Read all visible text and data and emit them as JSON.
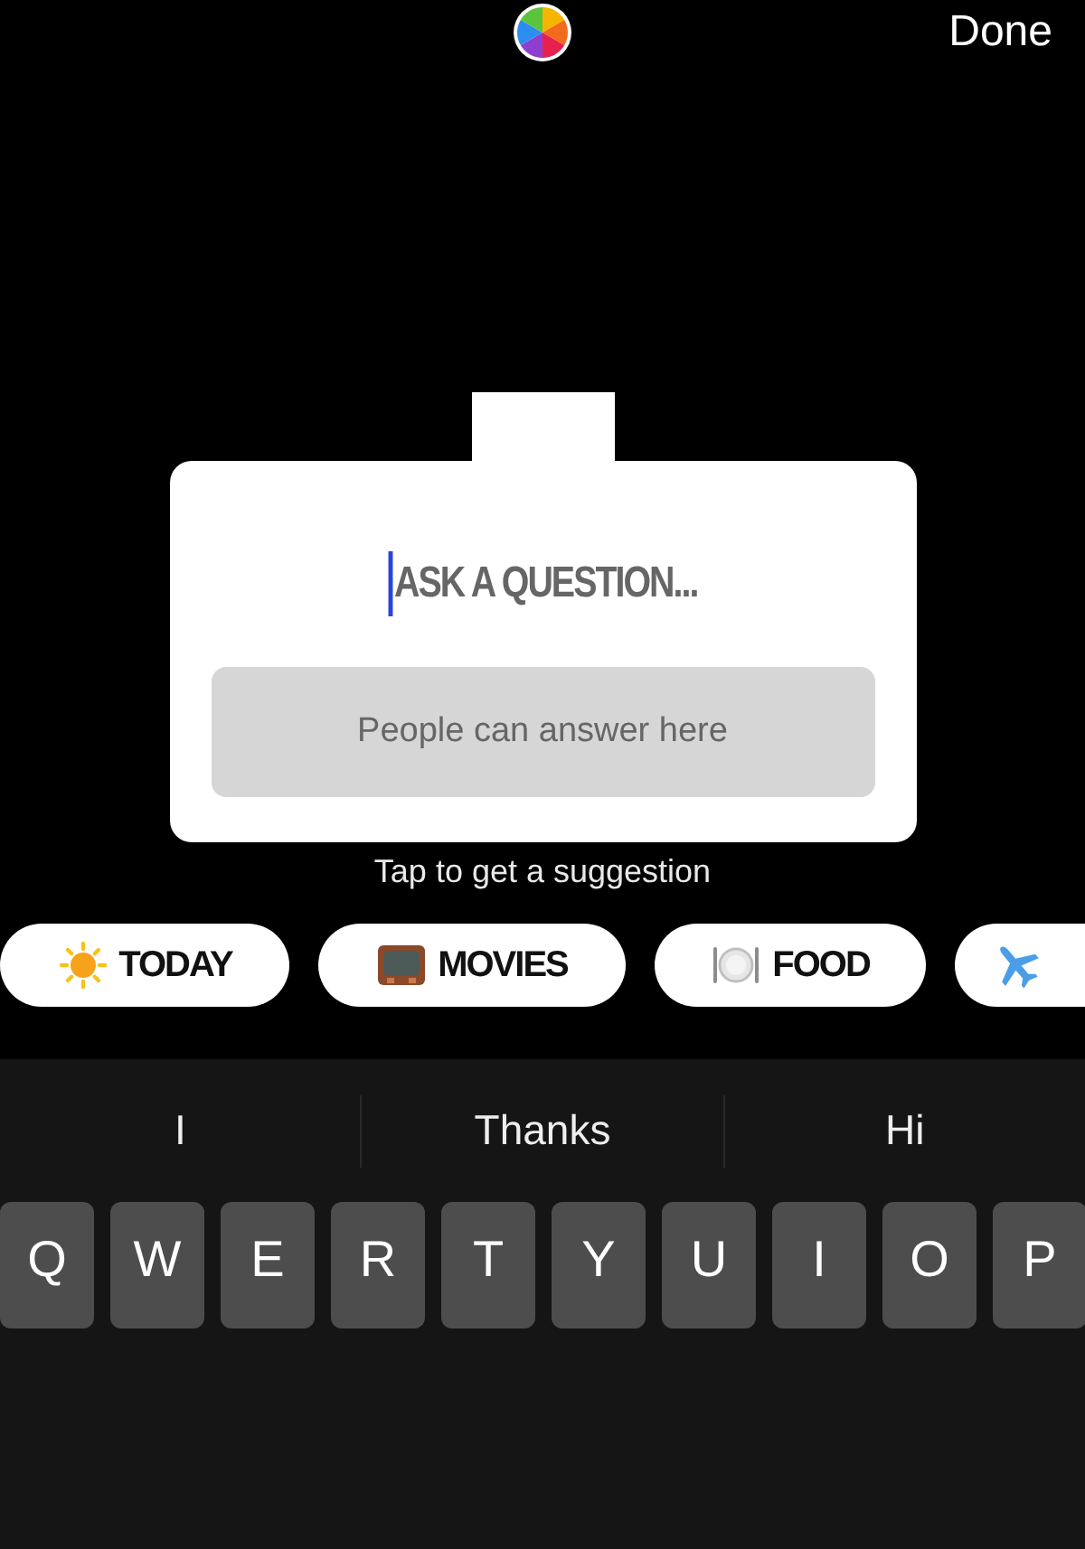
{
  "top_bar": {
    "done_label": "Done"
  },
  "question_sticker": {
    "question_placeholder": "ASK A QUESTION...",
    "answer_placeholder": "People can answer here"
  },
  "suggestion_hint": "Tap to get a suggestion",
  "suggestions": [
    {
      "kind": "sun",
      "label": "TODAY"
    },
    {
      "kind": "tv",
      "label": "MOVIES"
    },
    {
      "kind": "plate",
      "label": "FOOD"
    },
    {
      "kind": "plane"
    }
  ],
  "keyboard": {
    "predictions": [
      "I",
      "Thanks",
      "Hi"
    ],
    "keys": [
      "Q",
      "W",
      "E",
      "R",
      "T",
      "Y",
      "U",
      "I",
      "O",
      "P"
    ]
  }
}
